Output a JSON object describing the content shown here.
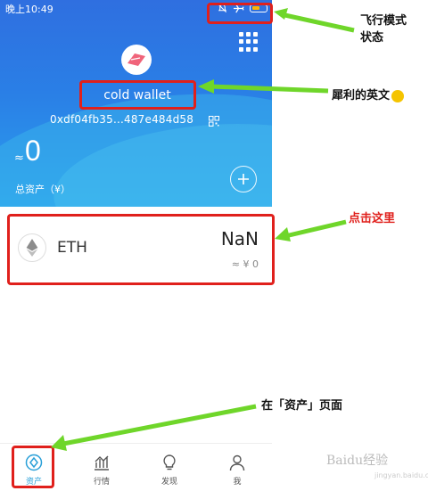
{
  "status_bar": {
    "time": "晚上10:49",
    "icons": [
      "bell-off-icon",
      "airplane-icon",
      "battery-icon"
    ]
  },
  "wallet": {
    "name": "cold wallet",
    "address": "0xdf04fb35...487e484d58",
    "approx_symbol": "≈",
    "balance": "0",
    "total_label": "总资产（¥）"
  },
  "assets": [
    {
      "symbol": "ETH",
      "amount": "NaN",
      "value": "≈ ¥ 0"
    }
  ],
  "tabbar": {
    "tabs": [
      {
        "label": "资产",
        "icon": "asset-icon",
        "active": true
      },
      {
        "label": "行情",
        "icon": "market-chart-icon",
        "active": false
      },
      {
        "label": "发现",
        "icon": "discover-bulb-icon",
        "active": false
      },
      {
        "label": "我",
        "icon": "profile-icon",
        "active": false
      }
    ]
  },
  "annotations": {
    "airplane_mode": "飞行模式\n状态",
    "wallet_name": "犀利的英文",
    "click_here": "点击这里",
    "assets_page": "在「资产」页面"
  },
  "watermark": {
    "brand": "Baidu经验",
    "url": "jingyan.baidu.com"
  },
  "colors": {
    "accent": "#2aa0d8",
    "annotation_red": "#e0201c",
    "arrow_green": "#6fd62a"
  }
}
